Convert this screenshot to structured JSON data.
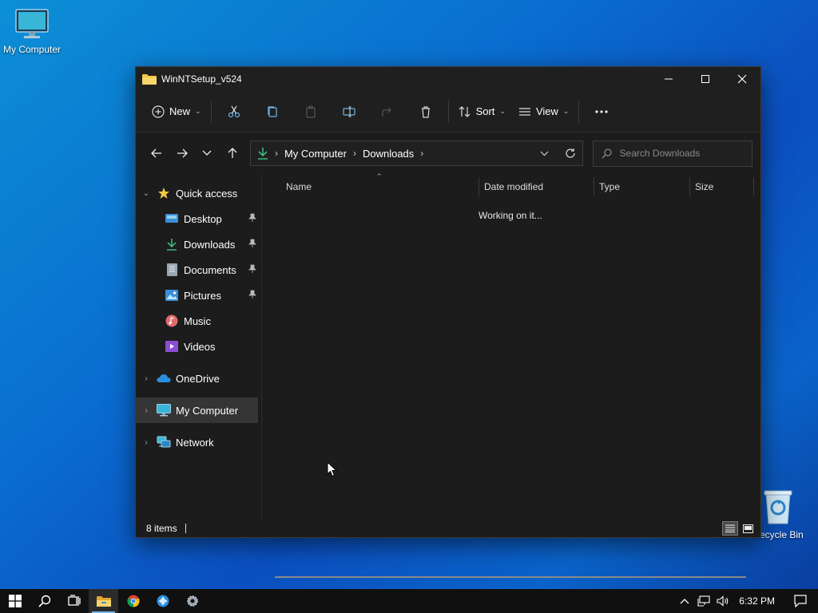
{
  "desktop": {
    "my_computer_label": "My Computer",
    "recycle_bin_label": "Recycle Bin"
  },
  "window": {
    "title": "WinNTSetup_v524",
    "controls": {
      "minimize": "minimize-icon",
      "maximize": "maximize-icon",
      "close": "close-icon"
    }
  },
  "commandbar": {
    "new_label": "New",
    "sort_label": "Sort",
    "view_label": "View",
    "icons": [
      "cut-icon",
      "copy-icon",
      "paste-icon",
      "rename-icon",
      "share-icon",
      "delete-icon",
      "more-icon"
    ]
  },
  "address": {
    "crumbs": [
      "My Computer",
      "Downloads"
    ],
    "search_placeholder": "Search Downloads"
  },
  "navpane": {
    "quick_access": "Quick access",
    "quick_items": [
      {
        "label": "Desktop",
        "pinned": true
      },
      {
        "label": "Downloads",
        "pinned": true
      },
      {
        "label": "Documents",
        "pinned": true
      },
      {
        "label": "Pictures",
        "pinned": true
      },
      {
        "label": "Music",
        "pinned": false
      },
      {
        "label": "Videos",
        "pinned": false
      }
    ],
    "onedrive": "OneDrive",
    "my_computer": "My Computer",
    "network": "Network"
  },
  "columns": [
    "Name",
    "Date modified",
    "Type",
    "Size"
  ],
  "content": {
    "status_message": "Working on it..."
  },
  "statusbar": {
    "items_text": "8 items"
  },
  "taskbar": {
    "apps": [
      "start-icon",
      "search-icon",
      "task-view-icon",
      "file-explorer-icon",
      "chrome-icon",
      "network-app-icon",
      "settings-gear-icon"
    ],
    "clock": "6:32 PM"
  },
  "colors": {
    "accent_blue": "#0a6fd0",
    "window_bg": "#1c1c1c",
    "folder_yellow": "#f2c744",
    "download_green": "#3fb77c"
  }
}
